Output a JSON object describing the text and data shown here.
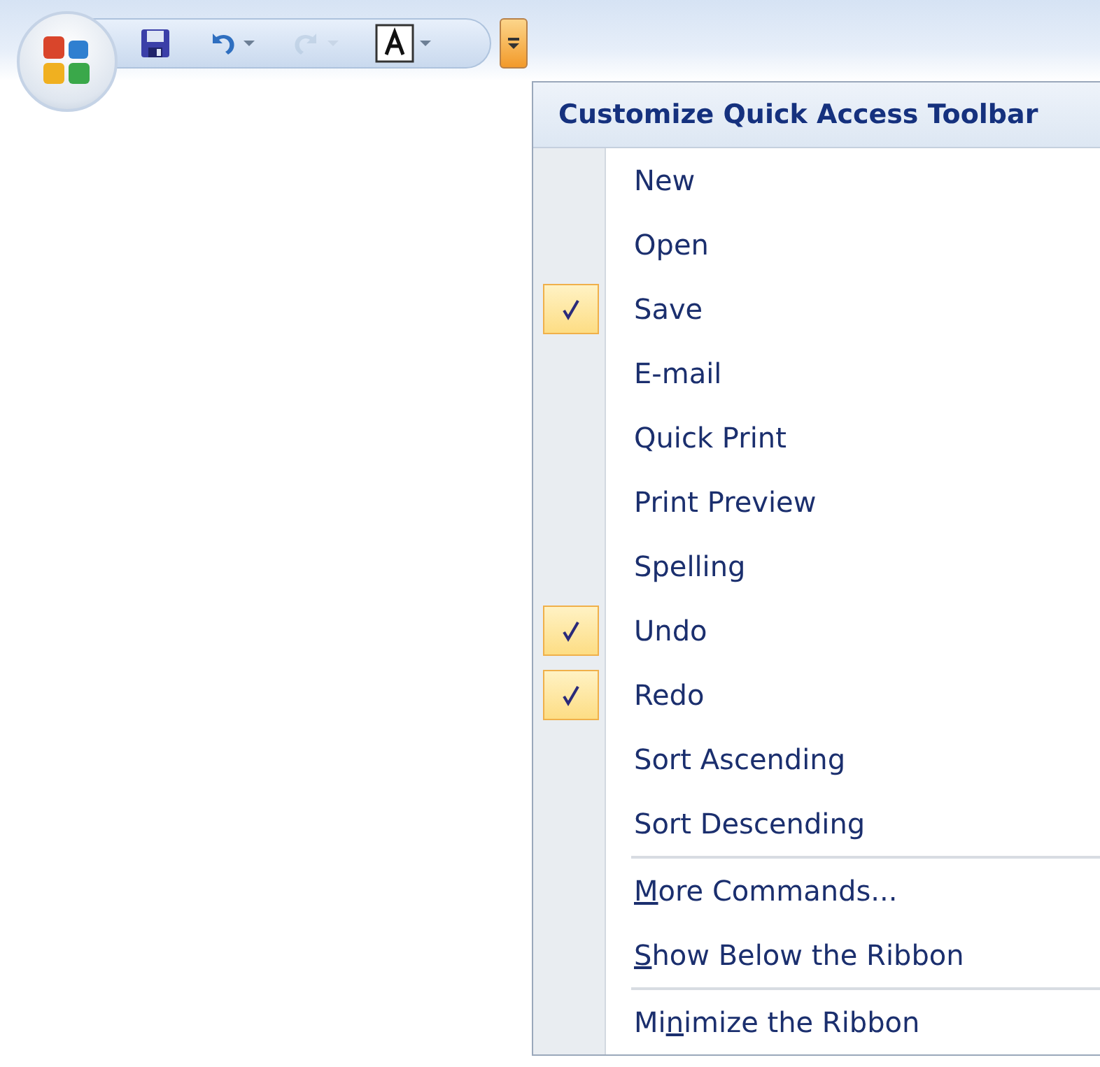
{
  "quick_access_toolbar": {
    "buttons": [
      {
        "kind": "save",
        "disabled": false
      },
      {
        "kind": "undo",
        "disabled": false
      },
      {
        "kind": "redo",
        "disabled": true
      },
      {
        "kind": "font",
        "disabled": false
      }
    ],
    "customize_open": true
  },
  "menu": {
    "title": "Customize Quick Access Toolbar",
    "commands": [
      {
        "label": "New",
        "checked": false
      },
      {
        "label": "Open",
        "checked": false
      },
      {
        "label": "Save",
        "checked": true
      },
      {
        "label": "E-mail",
        "checked": false
      },
      {
        "label": "Quick Print",
        "checked": false
      },
      {
        "label": "Print Preview",
        "checked": false
      },
      {
        "label": "Spelling",
        "checked": false
      },
      {
        "label": "Undo",
        "checked": true
      },
      {
        "label": "Redo",
        "checked": true
      },
      {
        "label": "Sort Ascending",
        "checked": false
      },
      {
        "label": "Sort Descending",
        "checked": false
      }
    ],
    "options": [
      {
        "access_key": "M",
        "after": "ore Commands...",
        "separator_before": true
      },
      {
        "access_key": "S",
        "after": "how Below the Ribbon",
        "separator_before": false
      },
      {
        "before": "Mi",
        "access_key": "n",
        "after": "imize the Ribbon",
        "separator_before": true
      }
    ]
  }
}
